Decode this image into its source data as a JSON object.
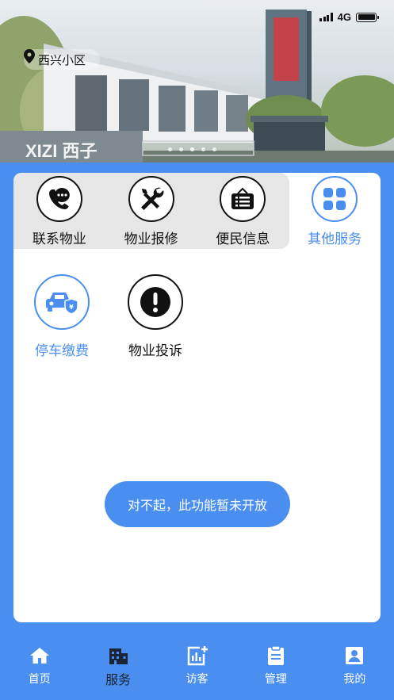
{
  "status_bar": {
    "network": "4G"
  },
  "header": {
    "location": "西兴小区",
    "banner_brand": "XIZI 西子"
  },
  "tabs": [
    {
      "label": "联系物业",
      "icon": "phone-chat-icon"
    },
    {
      "label": "物业报修",
      "icon": "tools-icon"
    },
    {
      "label": "便民信息",
      "icon": "notice-board-icon"
    },
    {
      "label": "其他服务",
      "icon": "grid-icon",
      "active": true
    }
  ],
  "services": [
    {
      "label": "停车缴费",
      "icon": "car-payment-icon"
    },
    {
      "label": "物业投诉",
      "icon": "exclamation-icon"
    }
  ],
  "toast": "对不起，此功能暂未开放",
  "nav": [
    {
      "label": "首页",
      "icon": "home-icon"
    },
    {
      "label": "服务",
      "icon": "building-icon",
      "active": true
    },
    {
      "label": "访客",
      "icon": "visitor-chart-icon"
    },
    {
      "label": "管理",
      "icon": "clipboard-icon"
    },
    {
      "label": "我的",
      "icon": "profile-icon"
    }
  ],
  "colors": {
    "accent": "#4a8ef0",
    "dark": "#1b2436"
  }
}
